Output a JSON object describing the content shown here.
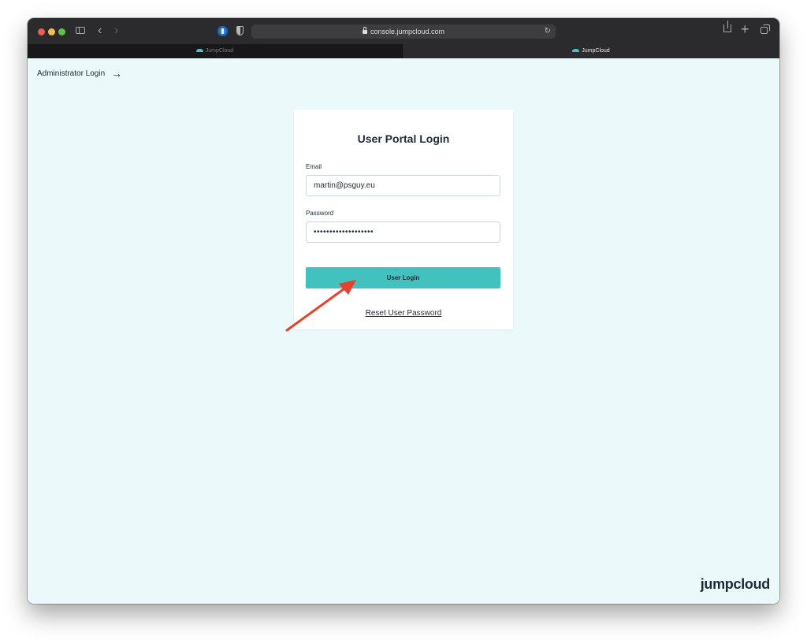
{
  "browser": {
    "address": "console.jumpcloud.com",
    "tabs": [
      {
        "label": "JumpCloud"
      },
      {
        "label": "JumpCloud"
      }
    ]
  },
  "page": {
    "admin_link": "Administrator Login",
    "card_title": "User Portal Login",
    "email_label": "Email",
    "email_value": "martin@psguy.eu",
    "password_label": "Password",
    "password_value": "•••••••••••••••••••",
    "login_button": "User Login",
    "reset_link": "Reset User Password",
    "brand": "jumpcloud"
  },
  "colors": {
    "page_background": "#ebf9fa",
    "button": "#42c2be",
    "annotation_arrow": "#e8402a"
  },
  "annotation": {
    "type": "arrow",
    "target": "login-button"
  }
}
